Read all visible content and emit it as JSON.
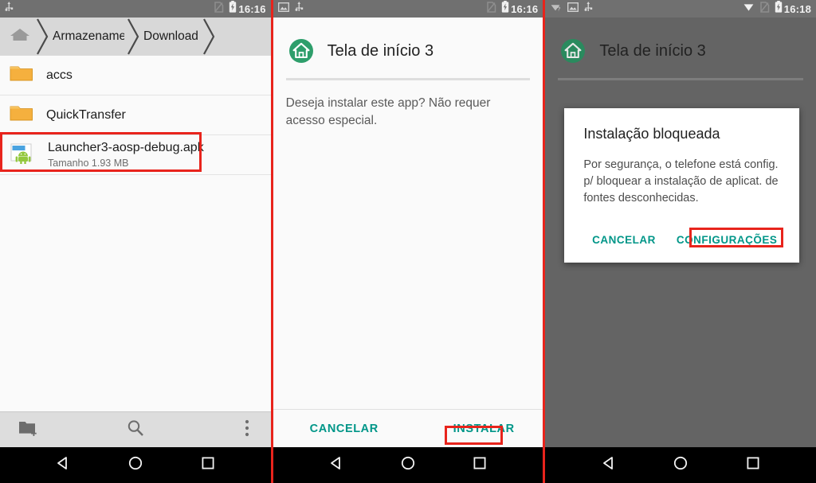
{
  "panels": {
    "file_manager": {
      "status_bar": {
        "time": "16:16",
        "left_icons": [
          "usb-icon"
        ],
        "right_icons": [
          "sim-missing-icon",
          "battery-charging-icon"
        ]
      },
      "breadcrumb": {
        "home_icon": "home-icon",
        "items": [
          {
            "label": "Armazenament",
            "truncated": true
          },
          {
            "label": "Download",
            "truncated": false
          }
        ]
      },
      "files": [
        {
          "name": "accs",
          "type": "folder",
          "icon": "folder-icon",
          "subtitle": ""
        },
        {
          "name": "QuickTransfer",
          "type": "folder",
          "icon": "folder-icon",
          "subtitle": ""
        },
        {
          "name": "Launcher3-aosp-debug.apk",
          "type": "apk",
          "icon": "apk-icon",
          "subtitle": "Tamanho 1.93 MB",
          "highlighted": true
        }
      ],
      "toolbar": [
        {
          "name": "new-folder",
          "icon": "new-folder-icon"
        },
        {
          "name": "search",
          "icon": "search-icon"
        },
        {
          "name": "more-options",
          "icon": "overflow-menu-icon"
        }
      ]
    },
    "installer": {
      "status_bar": {
        "time": "16:16",
        "left_icons": [
          "image-icon",
          "usb-icon"
        ],
        "right_icons": [
          "sim-missing-icon",
          "battery-charging-icon"
        ]
      },
      "app_icon": "home-app-icon",
      "app_title": "Tela de início 3",
      "message": "Deseja instalar este app? Não requer acesso especial.",
      "buttons": {
        "cancel": "CANCELAR",
        "install": "INSTALAR"
      },
      "install_highlighted": true
    },
    "blocked": {
      "status_bar": {
        "time": "16:18",
        "left_icons": [
          "wifi-question-icon",
          "image-icon",
          "usb-icon"
        ],
        "right_icons": [
          "wifi-icon",
          "sim-missing-icon",
          "battery-charging-icon"
        ]
      },
      "app_icon": "home-app-icon",
      "app_title": "Tela de início 3",
      "dialog": {
        "title": "Instalação bloqueada",
        "message": "Por segurança, o telefone está config. p/ bloquear a instalação de aplicat. de fontes desconhecidas.",
        "buttons": {
          "cancel": "CANCELAR",
          "settings": "CONFIGURAÇÕES"
        },
        "settings_highlighted": true
      }
    }
  },
  "nav_bar": {
    "back": "back-triangle-icon",
    "home": "home-circle-icon",
    "recents": "recents-square-icon"
  },
  "colors": {
    "accent_teal": "#009688",
    "highlight_red": "#e8241c",
    "folder_amber": "#f5b03e",
    "app_green": "#2e9e6b",
    "status_bar_gray": "#707070",
    "scrim_gray": "#646464"
  }
}
